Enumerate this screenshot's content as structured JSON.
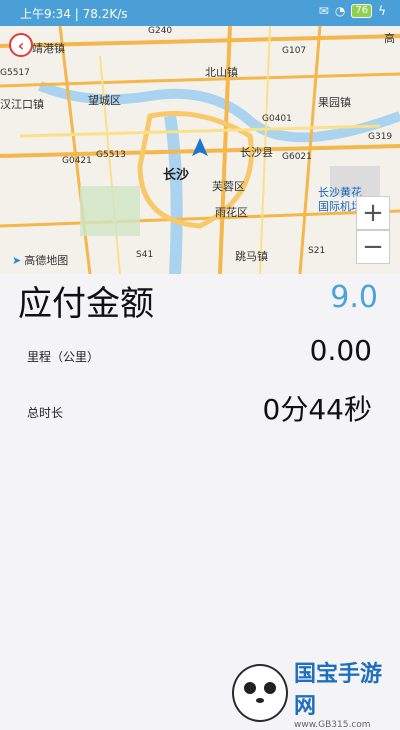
{
  "status": {
    "time": "上午9:34",
    "speed": "78.2K/s",
    "battery": "76"
  },
  "map": {
    "labels": [
      "靖港镇",
      "北山镇",
      "望城区",
      "果园镇",
      "汉江口镇",
      "长沙县",
      "长沙",
      "芙蓉区",
      "雨花区",
      "跳马镇",
      "长沙黄花",
      "国际机场",
      "高"
    ],
    "road_codes": [
      "G240",
      "G107",
      "G5517",
      "G0401",
      "G319",
      "G0421",
      "G5513",
      "G6021",
      "S41",
      "S21"
    ],
    "provider": "高德地图",
    "zoom_in": "+",
    "zoom_out": "−"
  },
  "fare": {
    "label": "应付金额",
    "value": "9.0"
  },
  "distance": {
    "label": "里程（公里）",
    "value": "0.00"
  },
  "duration": {
    "label": "总时长",
    "value": "0分44秒"
  },
  "watermark": {
    "brand": "国宝手游网",
    "url": "www.GB315.com"
  }
}
